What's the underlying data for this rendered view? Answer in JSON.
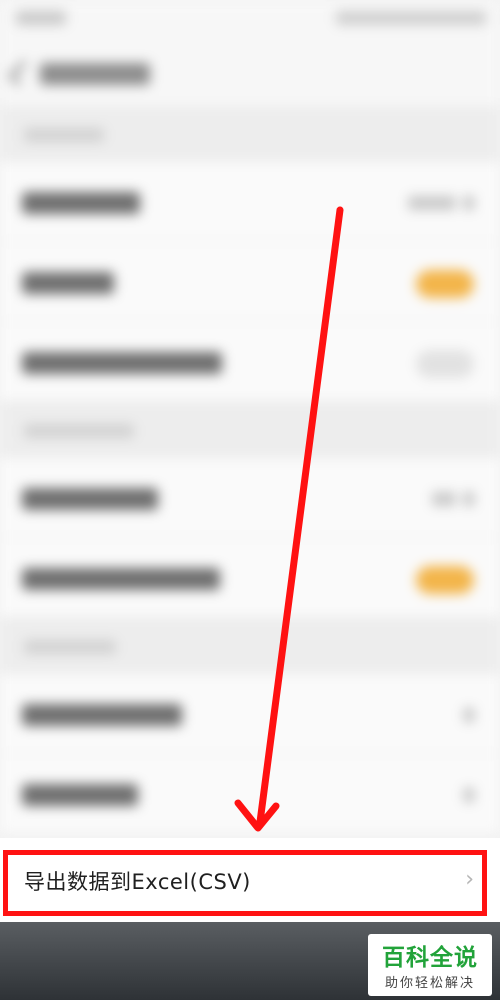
{
  "export_row": {
    "label": "导出数据到Excel(CSV)",
    "chevron": "›"
  },
  "watermark": {
    "main": "百科全说",
    "sub": "助你轻松解决"
  },
  "icons": {
    "back": "back-arrow-icon",
    "chevron": "chevron-right-icon"
  },
  "colors": {
    "highlight": "#ff1212",
    "toggle_on": "#f3b54a",
    "watermark_green": "#22a33a"
  }
}
